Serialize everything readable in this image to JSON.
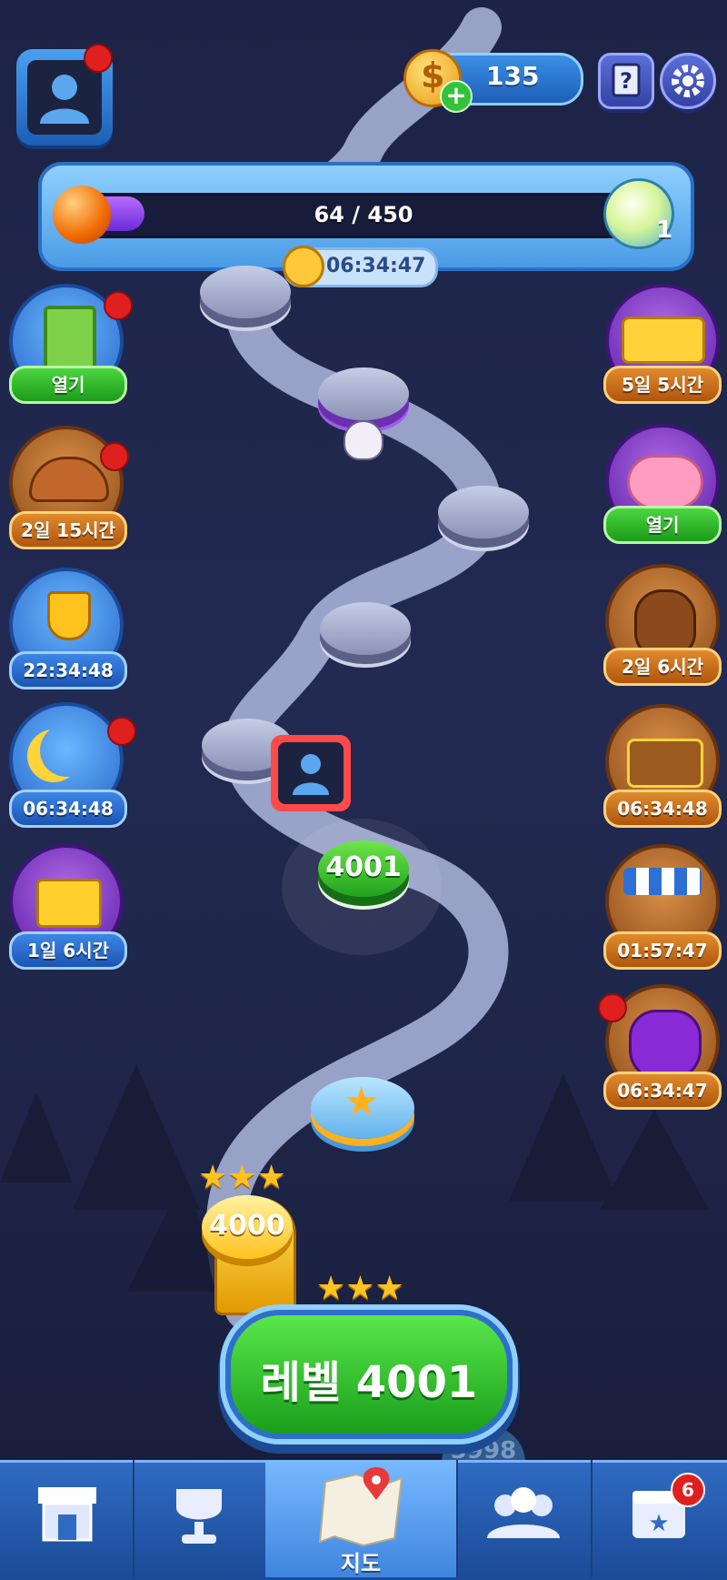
{
  "top_bar": {
    "coins": "135",
    "help_icon": "question-book-icon",
    "settings_icon": "gear-icon"
  },
  "progress": {
    "text": "64 / 450",
    "fraction": 0.142,
    "reward_count": "1",
    "timer": "06:34:47"
  },
  "left_events": [
    {
      "icon": "clipboard-icon",
      "label": "열기",
      "badge": true
    },
    {
      "icon": "cowboy-hat-icon",
      "label": "2일 15시간",
      "badge": true
    },
    {
      "icon": "trophy-icon",
      "label": "22:34:48",
      "badge": false
    },
    {
      "icon": "moon-icon",
      "label": "06:34:48",
      "badge": true
    },
    {
      "icon": "gift-box-icon",
      "label": "1일 6시간",
      "badge": false
    }
  ],
  "right_events": [
    {
      "icon": "golden-ticket-icon",
      "label": "5일 5시간",
      "badge": false
    },
    {
      "icon": "piggy-bank-icon",
      "label": "열기",
      "badge": false
    },
    {
      "icon": "money-bag-icon",
      "label": "2일 6시간",
      "badge": false
    },
    {
      "icon": "treasure-chest-icon",
      "label": "06:34:48",
      "badge": false
    },
    {
      "icon": "market-stall-icon",
      "label": "01:57:47",
      "badge": false
    },
    {
      "icon": "purple-coin-bag-icon",
      "label": "06:34:47",
      "badge": true
    }
  ],
  "map": {
    "current_level": "4001",
    "completed_level": "4000",
    "lower_level": "3998"
  },
  "play_button": "레벨 4001",
  "bottom_nav": [
    {
      "icon": "shop-icon",
      "label": ""
    },
    {
      "icon": "trophy-icon",
      "label": ""
    },
    {
      "icon": "map-icon",
      "label": "지도",
      "active": true
    },
    {
      "icon": "team-icon",
      "label": ""
    },
    {
      "icon": "calendar-star-icon",
      "label": "",
      "badge": "6"
    }
  ],
  "colors": {
    "background": "#1f2548",
    "path": "#b9c2e6",
    "accent_green": "#2fbf2a",
    "accent_blue": "#2f73d1"
  }
}
